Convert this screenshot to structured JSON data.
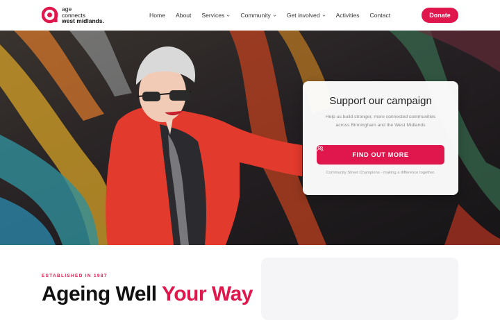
{
  "brand": {
    "name_line1": "age",
    "name_line2": "connects",
    "name_line3": "west midlands.",
    "color": "#e0174c",
    "logo_icon": "age-connects-logo-icon"
  },
  "nav": {
    "items": [
      {
        "label": "Home",
        "dropdown": false
      },
      {
        "label": "About",
        "dropdown": false
      },
      {
        "label": "Services",
        "dropdown": true
      },
      {
        "label": "Community",
        "dropdown": true
      },
      {
        "label": "Get involved",
        "dropdown": true
      },
      {
        "label": "Activities",
        "dropdown": false
      },
      {
        "label": "Contact",
        "dropdown": false
      }
    ],
    "dropdown_icon": "chevron-down-icon",
    "donate_label": "Donate"
  },
  "hero": {
    "image": "woman-in-red-jacket-with-graffiti-wall",
    "card": {
      "title": "Support our campaign",
      "body": "Help us build stronger, more connected communities across Birmingham and the West Midlands",
      "button_label": "FIND OUT MORE",
      "button_icon": "people-icon",
      "note": "Community Street Champions - making a difference together."
    }
  },
  "intro": {
    "eyebrow": "ESTABLISHED IN 1987",
    "headline_part1": "Ageing Well",
    "headline_part2": "Your Way"
  }
}
